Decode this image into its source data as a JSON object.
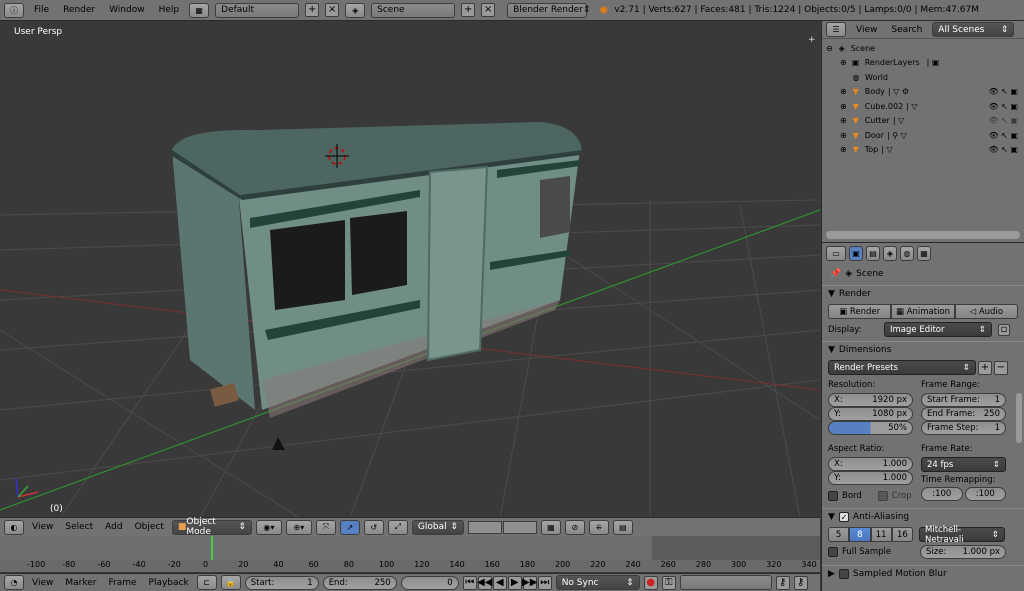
{
  "topbar": {
    "menus": [
      "File",
      "Render",
      "Window",
      "Help"
    ],
    "layout": "Default",
    "scene": "Scene",
    "engine": "Blender Render",
    "stats": "v2.71 | Verts:627 | Faces:481 | Tris:1224 | Objects:0/5 | Lamps:0/0 | Mem:47.67M"
  },
  "viewport": {
    "label": "User Persp",
    "frame_label": "(0)"
  },
  "view3d_header": {
    "menus": [
      "View",
      "Select",
      "Add",
      "Object"
    ],
    "mode": "Object Mode",
    "orientation": "Global"
  },
  "timeline": {
    "ticks": [
      "-100",
      "-80",
      "-60",
      "-40",
      "-20",
      "0",
      "20",
      "40",
      "60",
      "80",
      "100",
      "120",
      "140",
      "160",
      "180",
      "200",
      "220",
      "240",
      "260",
      "280",
      "300",
      "320",
      "340"
    ],
    "current_frame_value": 0,
    "menus": [
      "View",
      "Marker",
      "Frame",
      "Playback"
    ],
    "start_label": "Start:",
    "start": "1",
    "end_label": "End:",
    "end": "250",
    "current": "0",
    "sync": "No Sync"
  },
  "outliner": {
    "menus": [
      "View",
      "Search"
    ],
    "filter": "All Scenes",
    "items": [
      {
        "label": "Scene"
      },
      {
        "label": "RenderLayers"
      },
      {
        "label": "World"
      },
      {
        "label": "Body"
      },
      {
        "label": "Cube.002"
      },
      {
        "label": "Cutter"
      },
      {
        "label": "Door"
      },
      {
        "label": "Top"
      }
    ]
  },
  "properties": {
    "context": "Scene",
    "render_panel": "Render",
    "render_btn": "Render",
    "animation_btn": "Animation",
    "audio_btn": "Audio",
    "display_label": "Display:",
    "display_value": "Image Editor",
    "dimensions_panel": "Dimensions",
    "presets": "Render Presets",
    "resolution_label": "Resolution:",
    "res_x_label": "X:",
    "res_x": "1920 px",
    "res_y_label": "Y:",
    "res_y": "1080 px",
    "res_pct": "50%",
    "frame_range_label": "Frame Range:",
    "start_frame_label": "Start Frame:",
    "start_frame": "1",
    "end_frame_label": "End Frame:",
    "end_frame": "250",
    "frame_step_label": "Frame Step:",
    "frame_step": "1",
    "aspect_label": "Aspect Ratio:",
    "aspect_x_label": "X:",
    "aspect_x": "1.000",
    "aspect_y_label": "Y:",
    "aspect_y": "1.000",
    "frame_rate_label": "Frame Rate:",
    "frame_rate": "24 fps",
    "time_remap_label": "Time Remapping:",
    "remap_old": ":100",
    "remap_new": ":100",
    "bord_label": "Bord",
    "crop_label": "Crop",
    "aa_panel": "Anti-Aliasing",
    "aa_samples": [
      "5",
      "8",
      "11",
      "16"
    ],
    "aa_filter": "Mitchell-Netravali",
    "full_sample_label": "Full Sample",
    "size_label": "Size:",
    "size_value": "1.000 px",
    "smb_panel": "Sampled Motion Blur"
  },
  "colors": {
    "header": "#727272",
    "viewport_bg": "#393939",
    "accent_blue": "#5680c2",
    "x_axis": "#a03030",
    "y_axis": "#2f8f2f",
    "playhead": "#44cc44"
  }
}
